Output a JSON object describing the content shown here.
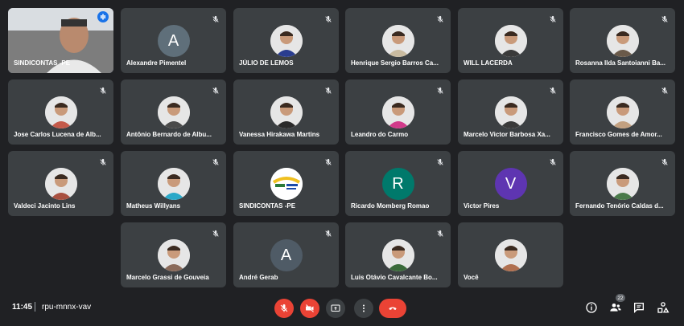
{
  "participants": [
    {
      "name": "SINDICONTAS -PE",
      "kind": "video",
      "speaking": true
    },
    {
      "name": "Alexandre Pimentel",
      "kind": "letter",
      "letter": "A",
      "color": "#5f6f7a",
      "muted": true
    },
    {
      "name": "JÚLIO DE LEMOS",
      "kind": "photo",
      "hue": "#2a3d8f",
      "muted": true
    },
    {
      "name": "Henrique Sergio Barros Ca...",
      "kind": "photo",
      "hue": "#c9bba0",
      "muted": true
    },
    {
      "name": "WILL LACERDA",
      "kind": "photo",
      "hue": "#3a3a3a",
      "muted": true
    },
    {
      "name": "Rosanna Ilda Santoianni Ba...",
      "kind": "photo",
      "hue": "#6a5a4a",
      "muted": true
    },
    {
      "name": "Jose Carlos Lucena de Alb...",
      "kind": "photo",
      "hue": "#c45a4a",
      "muted": true
    },
    {
      "name": "Antônio Bernardo de Albu...",
      "kind": "photo",
      "hue": "#4a4a4a",
      "muted": true
    },
    {
      "name": "Vanessa Hirakawa Martins",
      "kind": "photo",
      "hue": "#2a2a2a",
      "muted": true
    },
    {
      "name": "Leandro do Carmo",
      "kind": "photo",
      "hue": "#d23a8a",
      "muted": true
    },
    {
      "name": "Marcelo Victor Barbosa Xa...",
      "kind": "photo",
      "hue": "#3a3a3a",
      "muted": true
    },
    {
      "name": "Francisco Gomes de Amor...",
      "kind": "photo",
      "hue": "#c2a080",
      "muted": true
    },
    {
      "name": "Valdeci Jacinto Lins",
      "kind": "photo",
      "hue": "#a85040",
      "muted": true
    },
    {
      "name": "Matheus Willyans",
      "kind": "photo",
      "hue": "#2aa8c8",
      "muted": true
    },
    {
      "name": "SINDICONTAS -PE",
      "kind": "logo",
      "hue": "#f0c020",
      "muted": true
    },
    {
      "name": "Ricardo Momberg Romao",
      "kind": "letter",
      "letter": "R",
      "color": "#00796b",
      "muted": true
    },
    {
      "name": "Victor Pires",
      "kind": "letter",
      "letter": "V",
      "color": "#5e35b1",
      "muted": true
    },
    {
      "name": "Fernando Tenório Caldas d...",
      "kind": "photo",
      "hue": "#4a7a4a",
      "muted": true
    },
    {
      "name": "Marcelo Grassi de Gouveia",
      "kind": "photo",
      "hue": "#8a6a5a",
      "muted": true
    },
    {
      "name": "André Gerab",
      "kind": "letter",
      "letter": "A",
      "color": "#4f5b66",
      "muted": true
    },
    {
      "name": "Luis Otávio Cavalcante Bo...",
      "kind": "photo",
      "hue": "#3a6a3a",
      "muted": true
    },
    {
      "name": "Você",
      "kind": "photo",
      "hue": "#b07050",
      "muted": false
    }
  ],
  "bottom_bar": {
    "time": "11:45",
    "meeting_code": "rpu-mnnx-vav",
    "participant_count": "22"
  }
}
